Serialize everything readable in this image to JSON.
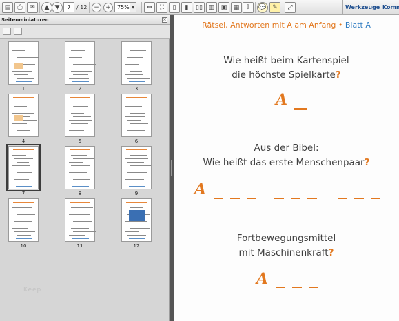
{
  "toolbar": {
    "page_current": "7",
    "page_total": "/ 12",
    "zoom": "75%",
    "links": [
      "Werkzeuge",
      "Komm"
    ]
  },
  "panel": {
    "title": "Seitenminiaturen",
    "thumbnails": [
      "1",
      "2",
      "3",
      "4",
      "5",
      "6",
      "7",
      "8",
      "9",
      "10",
      "11",
      "12"
    ],
    "selected_index": 7,
    "watermark": "Keep"
  },
  "document": {
    "header": {
      "title": "Rätsel, Antworten mit A am Anfang",
      "separator": "•",
      "sheet": "Blatt A"
    },
    "questions": [
      {
        "lines": [
          "Wie heißt beim Kartenspiel",
          "die höchste Spielkarte"
        ],
        "qmark": "?",
        "answer_letter": "A",
        "blanks": [
          1
        ]
      },
      {
        "lines": [
          "Aus der Bibel:",
          "Wie heißt das erste Menschenpaar"
        ],
        "qmark": "?",
        "answer_letter": "A",
        "blanks": [
          3,
          3,
          3
        ]
      },
      {
        "lines": [
          "Fortbewegungsmittel",
          "mit Maschinenkraft"
        ],
        "qmark": "?",
        "answer_letter": "A",
        "blanks": [
          3
        ]
      }
    ]
  },
  "colors": {
    "accent_orange": "#e2781f",
    "accent_blue": "#2f7cc1"
  }
}
